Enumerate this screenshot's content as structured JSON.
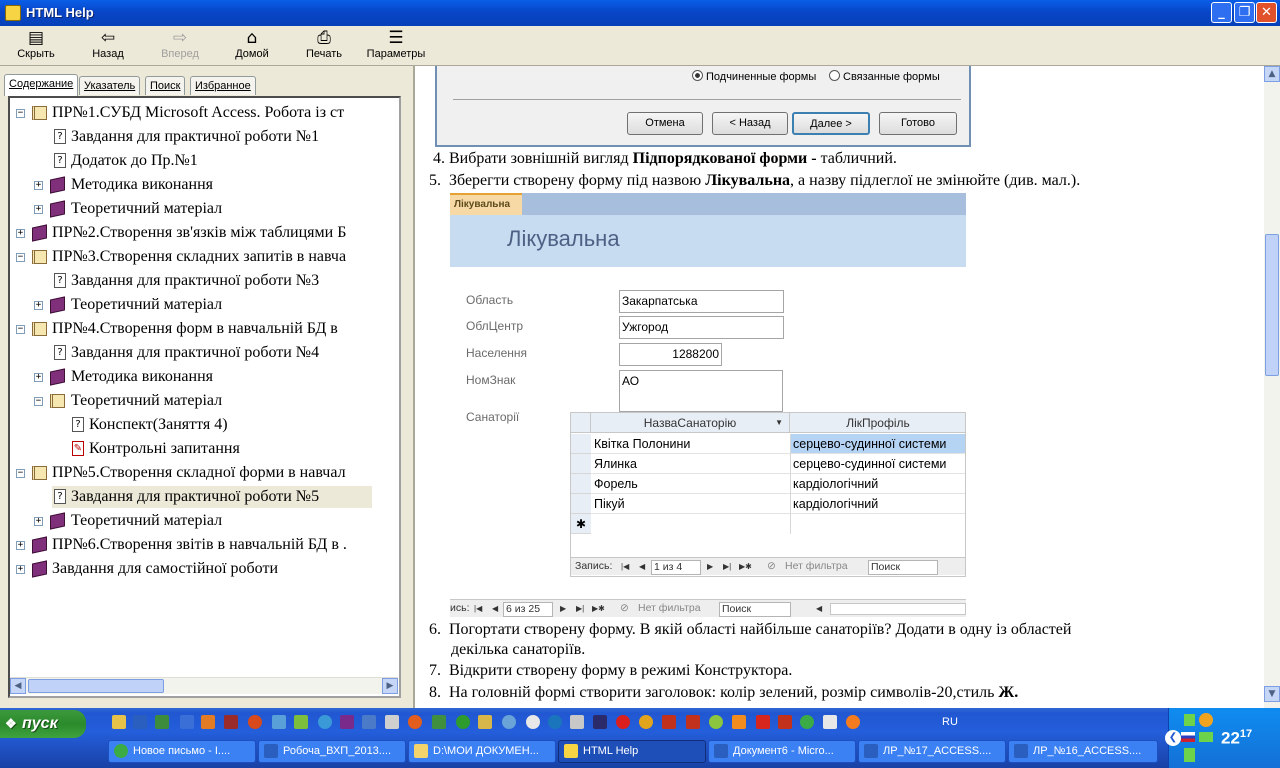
{
  "window": {
    "title": "HTML Help"
  },
  "toolbar": {
    "hide": "Скрыть",
    "back": "Назад",
    "forward": "Вперед",
    "home": "Домой",
    "print": "Печать",
    "options": "Параметры"
  },
  "tabs": [
    "Содержание",
    "Указатель",
    "Поиск",
    "Избранное"
  ],
  "tree": [
    "ПР№1.СУБД Microsoft Access. Робота із ст",
    "Завдання для практичної роботи №1",
    "Додаток до Пр.№1",
    "Методика виконання",
    "Теоретичний матеріал",
    "ПР№2.Створення зв'язків між таблицями Б",
    "ПР№3.Створення складних запитів в навча",
    "Завдання для практичної роботи №3",
    "Теоретичний матеріал",
    "ПР№4.Створення форм в навчальній БД в",
    "Завдання для практичної роботи №4",
    "Методика виконання",
    "Теоретичний матеріал",
    "Конспект(Заняття 4)",
    "Контрольні запитання",
    "ПР№5.Створення складної форми в навчал",
    "Завдання для практичної роботи №5",
    "Теоретичний матеріал",
    "ПР№6.Створення звітів в навчальній БД в .",
    "Завдання для самостійної роботи"
  ],
  "dialog": {
    "radio1": "Подчиненные формы",
    "radio2": "Связанные формы",
    "cancel": "Отмена",
    "back": "< Назад",
    "next": "Далее >",
    "done": "Готово"
  },
  "steps": {
    "s4n": "4.",
    "s4a": "Вибрати зовнішній вигляд ",
    "s4b": "Підпорядкованої форми - ",
    "s4c": "табличний.",
    "s5n": "5.",
    "s5a": "Зберегти створену форму під назвою ",
    "s5b": "Лікувальна",
    ", а назву": "",
    "s5c": ", а назву підлеглої не змінюйте (див. мал.).",
    "s6n": "6.",
    "s6a": "Погортати створену форму. В якій області найбільше санаторіїв? Додати в одну із областей",
    "s6b": "декілька санаторіїв.",
    "s7n": "7.",
    "s7a": "Відкрити створену форму в режимі Конструктора.",
    "s8n": "8.",
    "s8a": "На головній формі створити заголовок: колір зелений, розмір символів-20,стиль ",
    "s8b": "Ж."
  },
  "form": {
    "tab": "Лікувальна",
    "title": "Лікувальна",
    "labels": [
      "Область",
      "ОблЦентр",
      "Населення",
      "НомЗнак",
      "Санаторії"
    ],
    "values": [
      "Закарпатська",
      "Ужгород",
      "1288200",
      "АО"
    ],
    "grid_headers": [
      "НазваСанаторію",
      "ЛікПрофіль"
    ],
    "rows": [
      [
        "Квітка Полонини",
        "серцево-судинної системи"
      ],
      [
        "Ялинка",
        "серцево-судинної системи"
      ],
      [
        "Форель",
        "кардіологічний"
      ],
      [
        "Пікуй",
        "кардіологічний"
      ]
    ],
    "subnav": {
      "label": "Запись:",
      "record": "1 из 4",
      "filter": "Нет фильтра",
      "search": "Поиск"
    },
    "mainnav": {
      "label": "ись:",
      "record": "6 из 25",
      "filter": "Нет фильтра",
      "search": "Поиск"
    }
  },
  "taskbar": {
    "start": "пуск",
    "lang": "RU",
    "clock": "22",
    "clock_min": "17",
    "tasks": [
      "Новое письмо - I....",
      "Робоча_ВХП_2013....",
      "D:\\МОИ ДОКУМЕН...",
      "HTML Help",
      "Документ6 - Micro...",
      "ЛР_№17_ACCESS....",
      "ЛР_№16_ACCESS...."
    ]
  }
}
